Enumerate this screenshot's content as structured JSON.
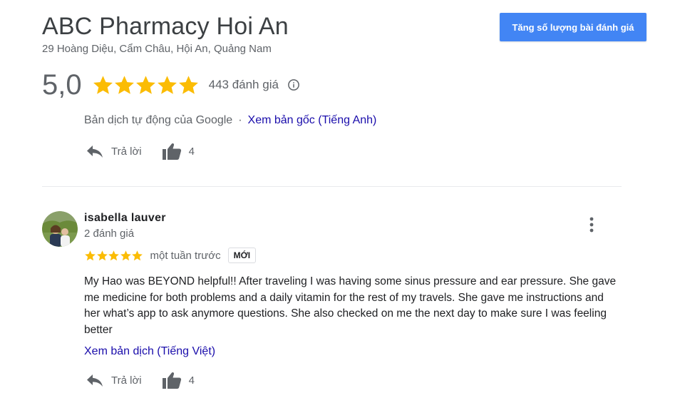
{
  "business": {
    "name": "ABC Pharmacy Hoi An",
    "address": "29 Hoàng Diệu, Cẩm Châu, Hội An, Quảng Nam",
    "rating": "5,0",
    "stars": 5,
    "review_count": "443 đánh giá",
    "cta_label": "Tăng số lượng bài đánh giá",
    "accent_color": "#4285f4",
    "star_color": "#fbbc04"
  },
  "previous_review": {
    "translation_note": "Bản dịch tự động của Google",
    "view_original_link": "Xem bản gốc (Tiếng Anh)",
    "reply_label": "Trả lời",
    "like_count": "4"
  },
  "review": {
    "reviewer_name": "isabella lauver",
    "reviewer_reviews": "2 đánh giá",
    "stars": 5,
    "date": "một tuần trước",
    "badge": "MỚI",
    "text": "My Hao was BEYOND helpful!! After traveling I was having some sinus pressure and ear pressure. She gave me medicine for both problems and a daily vitamin for the rest of my travels. She gave me instructions and her what’s app to ask anymore questions. She also checked on me the next day to make sure I was feeling better",
    "view_translation_link": "Xem bản dịch (Tiếng Việt)",
    "reply_label": "Trả lời",
    "like_count": "4"
  },
  "icons": {
    "info": "info-icon",
    "reply": "reply-icon",
    "thumbs_up": "thumbs-up-icon",
    "more": "more-vert-icon",
    "star": "star-icon"
  }
}
